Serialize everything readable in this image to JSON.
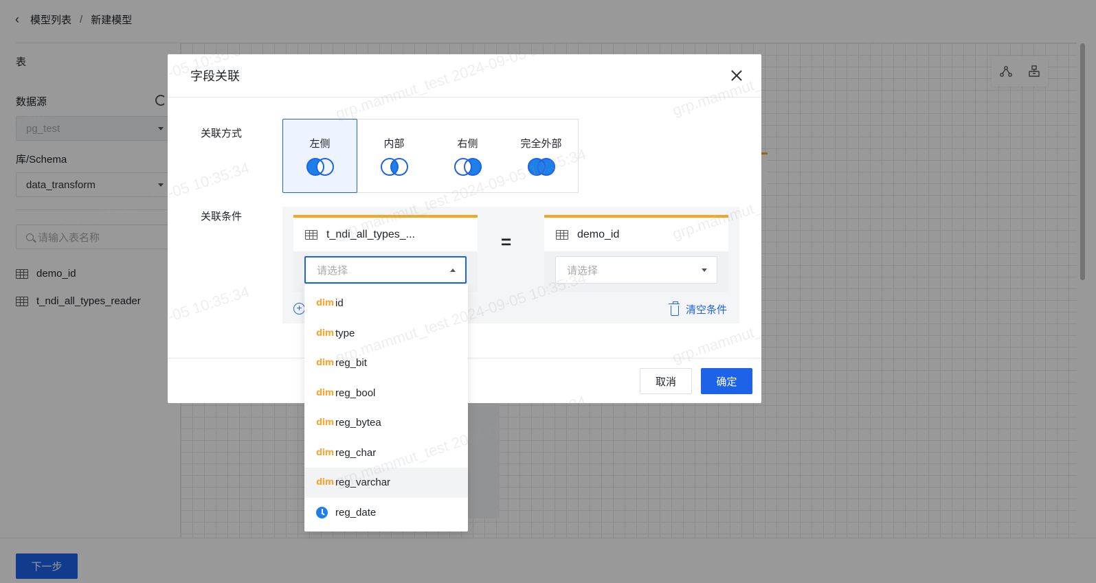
{
  "breadcrumb": {
    "items": [
      "模型列表",
      "新建模型"
    ],
    "separator": "/"
  },
  "sidebar": {
    "title": "表",
    "datasource_label": "数据源",
    "datasource_value": "pg_test",
    "schema_label": "库/Schema",
    "schema_value": "data_transform",
    "search_placeholder": "请输入表名称",
    "tables": [
      "demo_id",
      "t_ndi_all_types_reader"
    ]
  },
  "footer": {
    "next_label": "下一步"
  },
  "modal": {
    "title": "字段关联",
    "join_label": "关联方式",
    "join_types": [
      {
        "label": "左侧",
        "kind": "left",
        "active": true
      },
      {
        "label": "内部",
        "kind": "inner",
        "active": false
      },
      {
        "label": "右侧",
        "kind": "right",
        "active": false
      },
      {
        "label": "完全外部",
        "kind": "full",
        "active": false
      }
    ],
    "cond_label": "关联条件",
    "left_table": "t_ndi_all_types_...",
    "right_table": "demo_id",
    "left_placeholder": "请选择",
    "right_placeholder": "请选择",
    "equals": "=",
    "add_symbol": "+",
    "clear_label": "清空条件",
    "cancel_label": "取消",
    "ok_label": "确定"
  },
  "dropdown": {
    "dim_tag": "dim",
    "fields": [
      {
        "name": "id",
        "icon": "dim"
      },
      {
        "name": "type",
        "icon": "dim"
      },
      {
        "name": "reg_bit",
        "icon": "dim"
      },
      {
        "name": "reg_bool",
        "icon": "dim"
      },
      {
        "name": "reg_bytea",
        "icon": "dim"
      },
      {
        "name": "reg_char",
        "icon": "dim"
      },
      {
        "name": "reg_varchar",
        "icon": "dim",
        "hovered": true
      },
      {
        "name": "reg_date",
        "icon": "clock"
      }
    ]
  },
  "watermark": "grp.mammut_test 2024-09-05 10:35:34",
  "colors": {
    "primary": "#1d63ea",
    "accent": "#f5a623",
    "venn_fill": "#1d7fe8"
  }
}
